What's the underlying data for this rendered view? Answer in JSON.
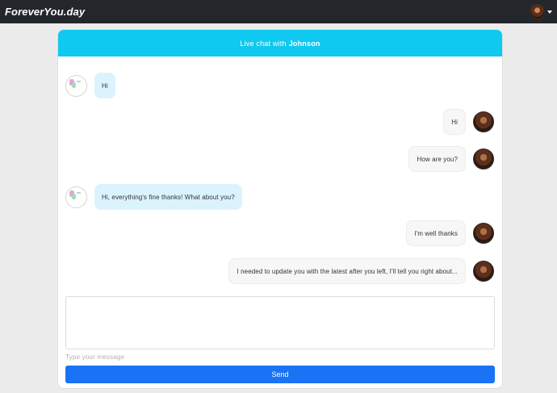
{
  "navbar": {
    "brand": "ForeverYou.day",
    "user_avatar_icon": "user-avatar-icon",
    "dropdown_icon": "caret-down-icon"
  },
  "chat": {
    "header_prefix": "Live chat with",
    "header_name": "Johnson",
    "header_color": "#10c9f0",
    "messages": [
      {
        "from": "bot",
        "text": "Hi"
      },
      {
        "from": "user",
        "text": "Hi"
      },
      {
        "from": "user",
        "text": "How are you?"
      },
      {
        "from": "bot",
        "text": "Hi, everything's fine thanks! What about you?"
      },
      {
        "from": "user",
        "text": "I'm well thanks"
      },
      {
        "from": "user",
        "text": "I needed to update you with the latest after you left, I'll tell you right about..."
      }
    ]
  },
  "composer": {
    "textarea_value": "",
    "help_text": "Type your message",
    "send_label": "Send",
    "send_color": "#1a73f5"
  }
}
